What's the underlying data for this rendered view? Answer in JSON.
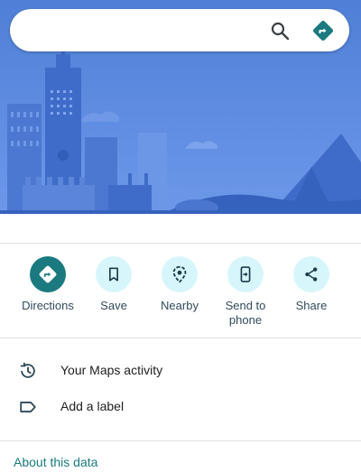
{
  "search": {
    "placeholder": "",
    "search_icon": "search-icon",
    "directions_icon": "directions-diamond-icon"
  },
  "colors": {
    "hero_sky": "#5a86dd",
    "hero_buildings": "#4a76cf",
    "action_primary": "#1a7a7f",
    "action_bg": "#d7f6fb",
    "link": "#1a7a7f"
  },
  "actions": [
    {
      "label": "Directions",
      "icon": "directions-icon"
    },
    {
      "label": "Save",
      "icon": "bookmark-icon"
    },
    {
      "label": "Nearby",
      "icon": "nearby-pin-icon"
    },
    {
      "label": "Send to\nphone",
      "icon": "send-to-phone-icon"
    },
    {
      "label": "Share",
      "icon": "share-icon"
    }
  ],
  "list": [
    {
      "label": "Your Maps activity",
      "icon": "history-icon"
    },
    {
      "label": "Add a label",
      "icon": "label-icon"
    }
  ],
  "footer": {
    "about_link": "About this data"
  }
}
